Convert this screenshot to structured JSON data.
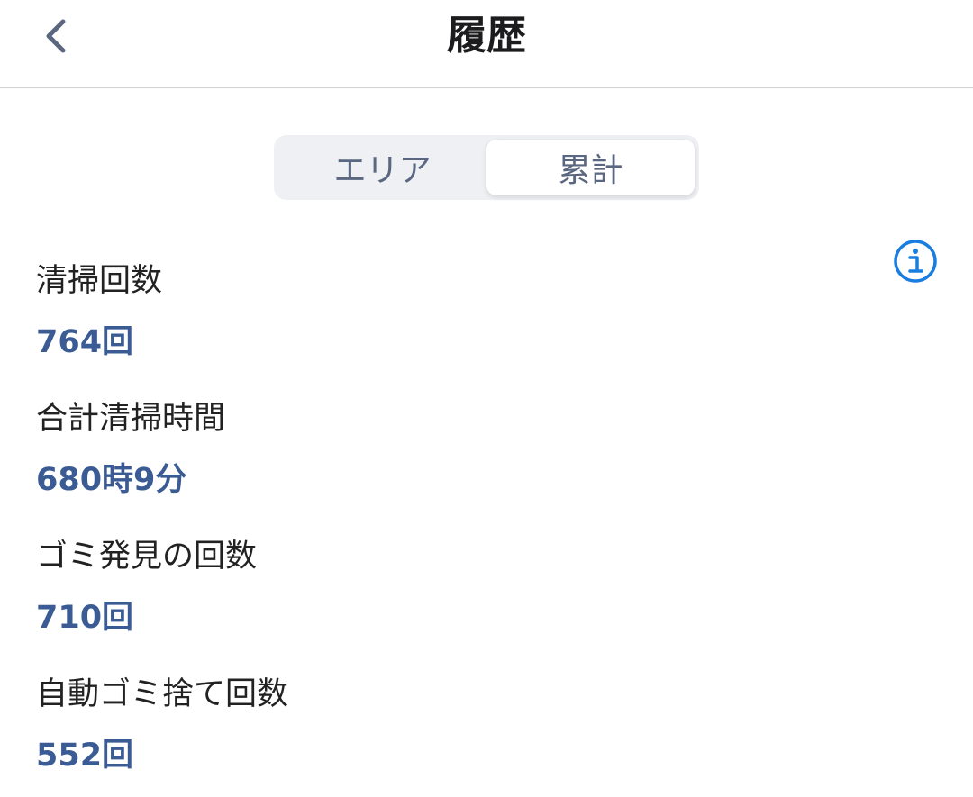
{
  "header": {
    "title": "履歴",
    "back_icon": "chevron-left-icon"
  },
  "tabs": [
    {
      "label": "エリア",
      "selected": false
    },
    {
      "label": "累計",
      "selected": true
    }
  ],
  "info_icon": "info-icon",
  "stats": [
    {
      "label": "清掃回数",
      "value": "764回"
    },
    {
      "label": "合計清掃時間",
      "value": "680時9分"
    },
    {
      "label": "ゴミ発見の回数",
      "value": "710回"
    },
    {
      "label": "自動ゴミ捨て回数",
      "value": "552回"
    }
  ],
  "colors": {
    "accent_value": "#3a5b94",
    "info_blue": "#1a7ee0",
    "segment_text": "#5b6780"
  }
}
